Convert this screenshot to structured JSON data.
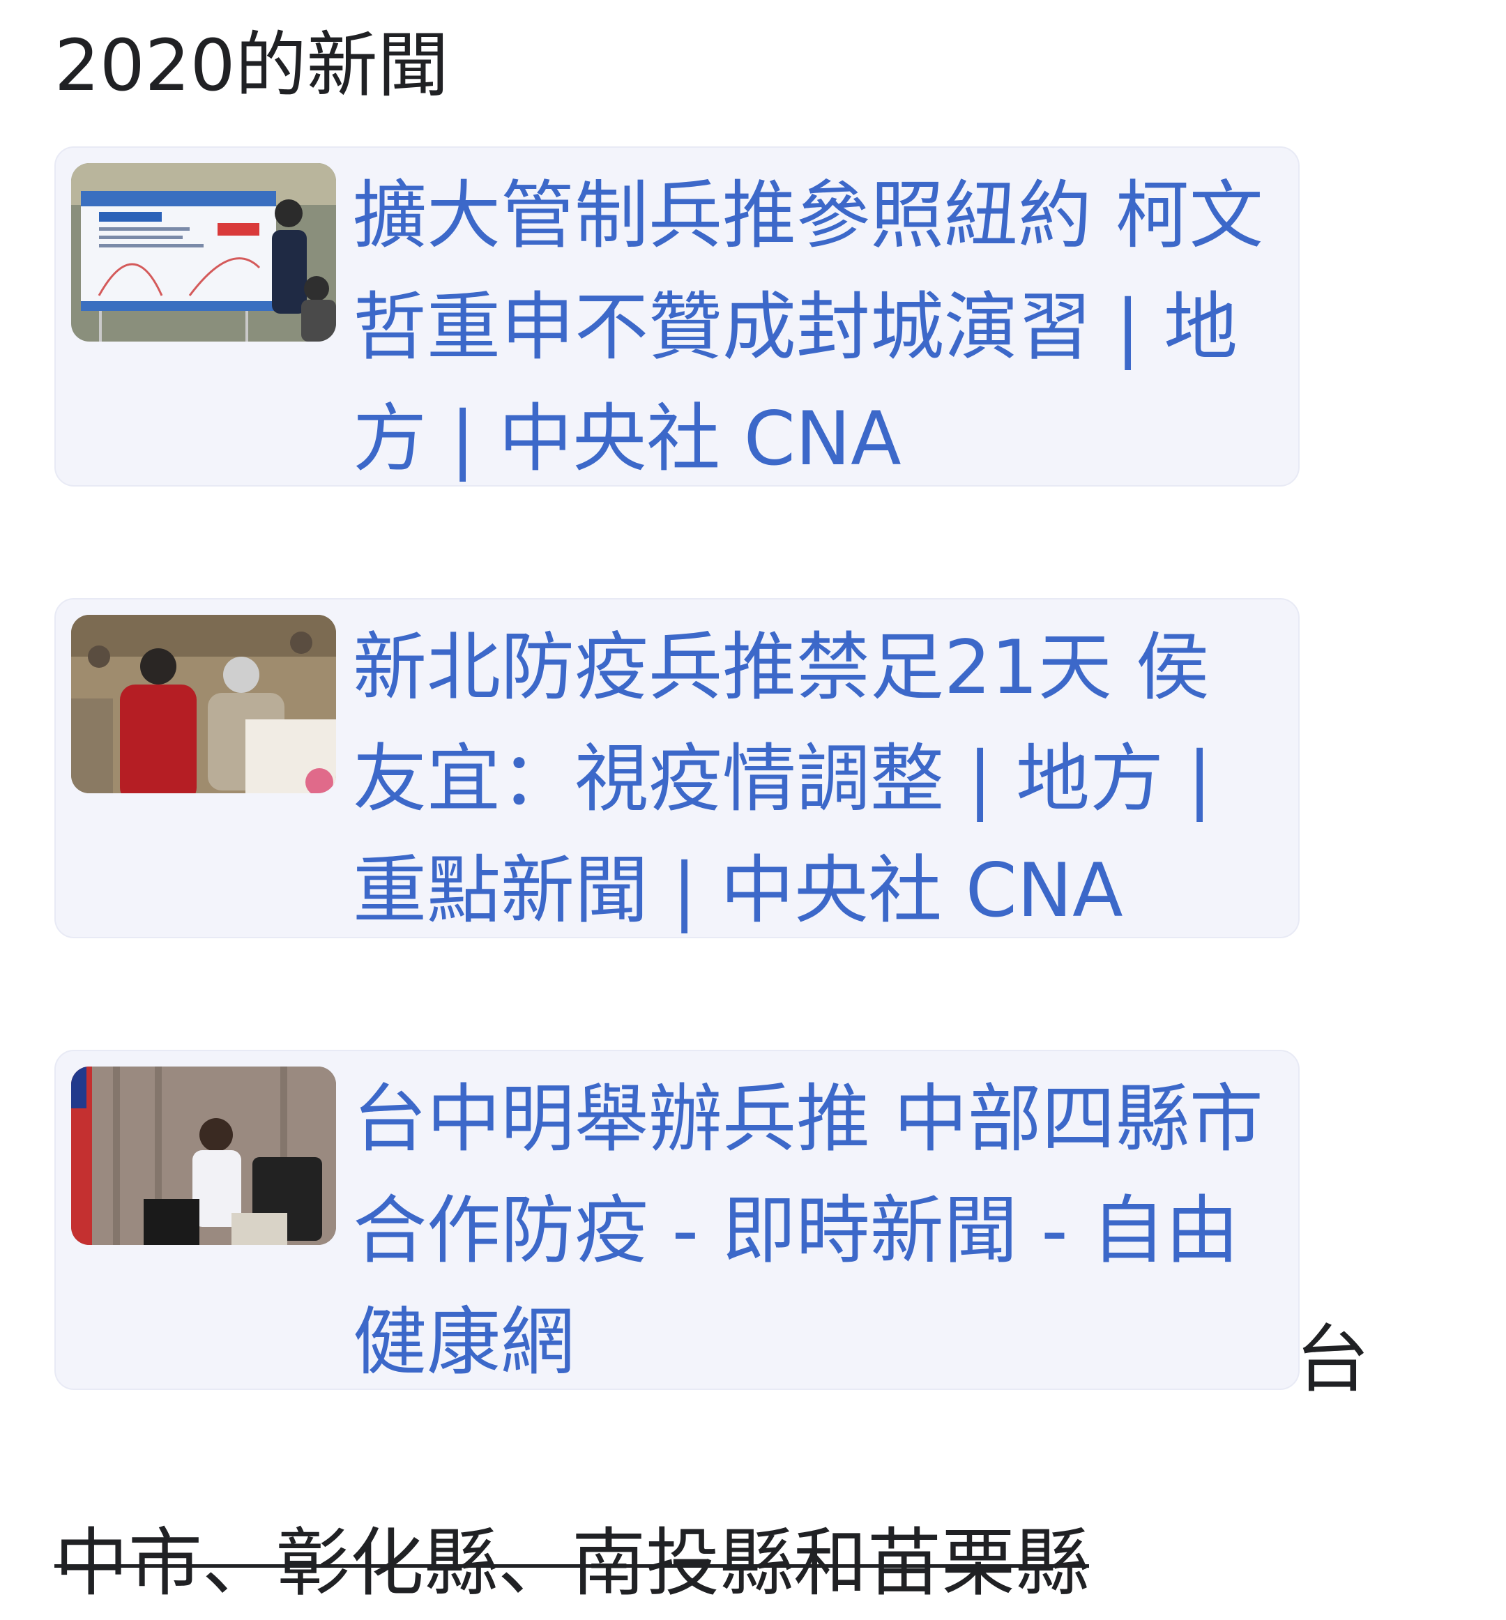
{
  "section": {
    "heading": "2020的新聞"
  },
  "cards": [
    {
      "title": "擴大管制兵推參照紐約 柯文哲重申不贊成封城演習 | 地方 | 中央社 CNA",
      "image": "press-briefing-photo"
    },
    {
      "title": "新北防疫兵推禁足21天 侯友宜：視疫情調整 | 地方 | 重點新聞 | 中央社 CNA",
      "image": "officials-meeting-photo"
    },
    {
      "title": "台中明舉辦兵推 中部四縣市合作防疫 - 即時新聞 - 自由健康網",
      "image": "mayor-at-podium-photo"
    }
  ],
  "trailing_text": "台",
  "struck_text": "中市、彰化縣、南投縣和苗栗縣",
  "colors": {
    "link": "#3c68c9",
    "card_bg": "#f3f4fb",
    "text": "#202124"
  }
}
